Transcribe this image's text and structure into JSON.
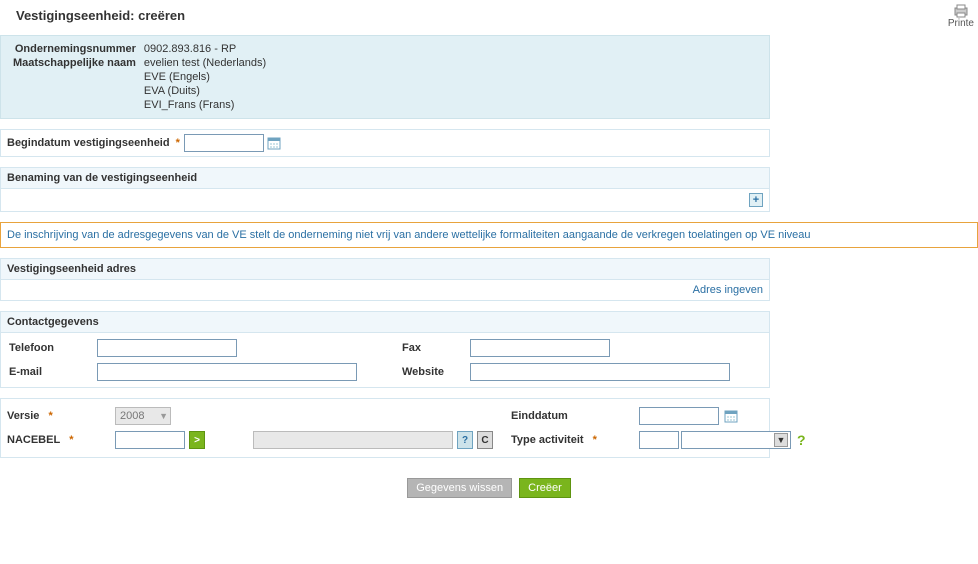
{
  "page": {
    "title": "Vestigingseenheid: creëren",
    "print_label": "Printe"
  },
  "company": {
    "enterprise_number_label": "Ondernemingsnummer",
    "enterprise_number": "0902.893.816  - RP",
    "company_name_label": "Maatschappelijke naam",
    "names": [
      "evelien test (Nederlands)",
      "EVE (Engels)",
      "EVA (Duits)",
      "EVI_Frans (Frans)"
    ]
  },
  "start_date": {
    "label": "Begindatum vestigingseenheid",
    "required": "*",
    "value": ""
  },
  "naming": {
    "header": "Benaming van de vestigingseenheid"
  },
  "warning": "De inschrijving van de adresgegevens van de VE stelt de onderneming niet vrij van andere wettelijke formaliteiten aangaande de verkregen toelatingen op VE niveau",
  "address": {
    "header": "Vestigingseenheid adres",
    "link": "Adres ingeven"
  },
  "contact": {
    "header": "Contactgegevens",
    "phone_label": "Telefoon",
    "phone": "",
    "fax_label": "Fax",
    "fax": "",
    "email_label": "E-mail",
    "email": "",
    "website_label": "Website",
    "website": ""
  },
  "activity": {
    "version_label": "Versie",
    "version_value": "2008",
    "required": "*",
    "nacebel_label": "NACEBEL",
    "nacebel_code": "",
    "nacebel_desc": "",
    "help_q": "?",
    "help_c": "C",
    "enddate_label": "Einddatum",
    "enddate": "",
    "type_label": "Type activiteit",
    "type_code": "",
    "type_value": ""
  },
  "buttons": {
    "clear": "Gegevens wissen",
    "create": "Creëer"
  }
}
